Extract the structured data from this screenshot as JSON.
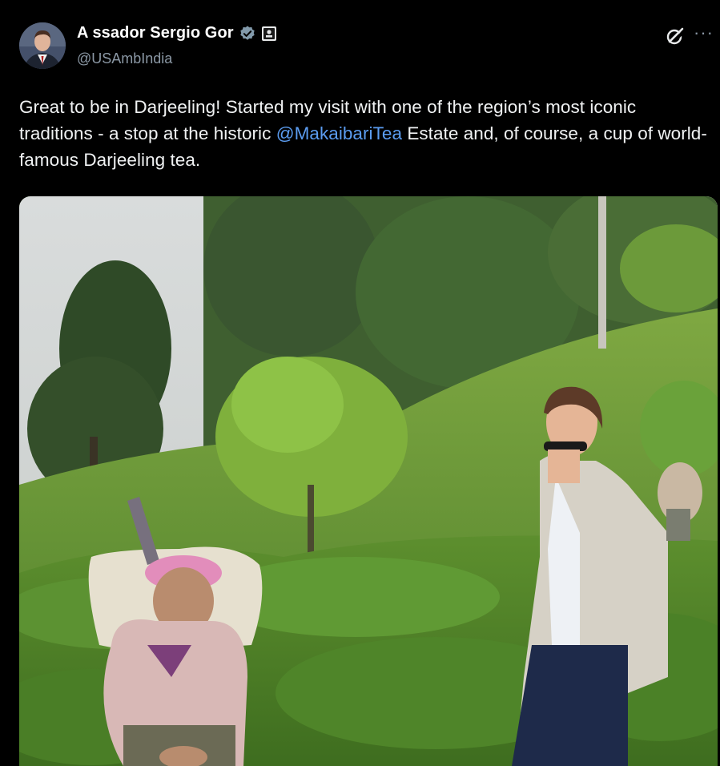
{
  "author": {
    "display_name": "A  ssador Sergio Gor",
    "handle": "@USAmbIndia",
    "avatar_icon": "profile-photo-icon",
    "verified_icon": "verified-badge-icon",
    "affiliation_icon": "government-badge-icon"
  },
  "actions": {
    "grok_icon": "grok-icon",
    "more_label": "···"
  },
  "tweet": {
    "text_part1": "Great to be in Darjeeling! Started my visit with one of the region’s most iconic traditions - a stop at the historic ",
    "mention": "@MakaibariTea",
    "text_part2": " Estate and, of course, a cup of world-famous Darjeeling tea."
  },
  "media": {
    "type": "photo",
    "subject": "tea-estate-photo"
  },
  "colors": {
    "background": "#000000",
    "text": "#e7e9ea",
    "secondary_text": "#8b98a5",
    "link": "#5b9cf0",
    "verified": "#829aab"
  }
}
